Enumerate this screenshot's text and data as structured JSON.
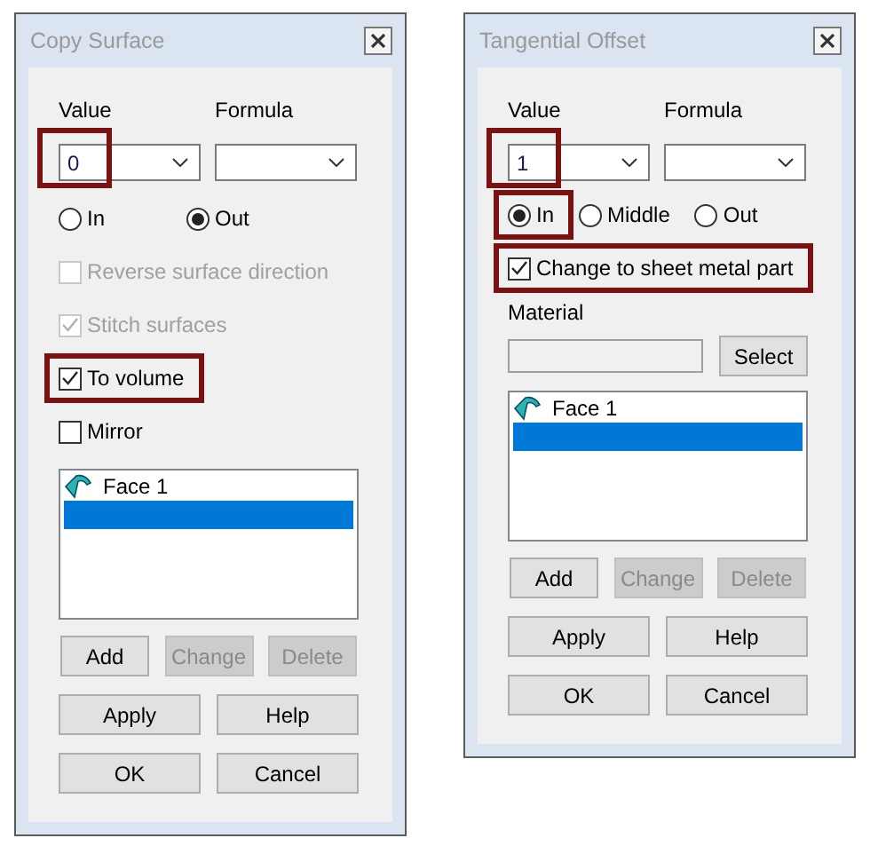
{
  "dialogs": [
    {
      "title": "Copy Surface",
      "value": {
        "label": "Value",
        "text": "0",
        "highlighted": true
      },
      "formula": {
        "label": "Formula"
      },
      "radios": [
        {
          "label": "In",
          "selected": false,
          "highlighted": false
        },
        {
          "label": "Out",
          "selected": true,
          "highlighted": false
        }
      ],
      "checkboxes": [
        {
          "label": "Reverse surface direction",
          "checked": false,
          "disabled": true,
          "highlighted": false
        },
        {
          "label": "Stitch surfaces",
          "checked": true,
          "disabled": true,
          "highlighted": false
        },
        {
          "label": "To volume",
          "checked": true,
          "disabled": false,
          "highlighted": true
        },
        {
          "label": "Mirror",
          "checked": false,
          "disabled": false,
          "highlighted": false
        }
      ],
      "list": [
        {
          "label": "Face 1",
          "selected": false
        },
        {
          "selected": true
        }
      ],
      "button_rows": [
        [
          {
            "label": "Add",
            "disabled": false
          },
          {
            "label": "Change",
            "disabled": true
          },
          {
            "label": "Delete",
            "disabled": true
          }
        ],
        [
          {
            "label": "Apply",
            "disabled": false
          },
          {
            "label": "Help",
            "disabled": false
          }
        ],
        [
          {
            "label": "OK",
            "disabled": false
          },
          {
            "label": "Cancel",
            "disabled": false
          }
        ]
      ]
    },
    {
      "title": "Tangential Offset",
      "value": {
        "label": "Value",
        "text": "1",
        "highlighted": true
      },
      "formula": {
        "label": "Formula"
      },
      "radios": [
        {
          "label": "In",
          "selected": true,
          "highlighted": true
        },
        {
          "label": "Middle",
          "selected": false,
          "highlighted": false
        },
        {
          "label": "Out",
          "selected": false,
          "highlighted": false
        }
      ],
      "checkboxes": [
        {
          "label": "Change to sheet metal part",
          "checked": true,
          "disabled": false,
          "highlighted": true
        }
      ],
      "material": {
        "label": "Material",
        "button": "Select"
      },
      "list": [
        {
          "label": "Face 1",
          "selected": false
        },
        {
          "selected": true
        }
      ],
      "button_rows": [
        [
          {
            "label": "Add",
            "disabled": false
          },
          {
            "label": "Change",
            "disabled": true
          },
          {
            "label": "Delete",
            "disabled": true
          }
        ],
        [
          {
            "label": "Apply",
            "disabled": false
          },
          {
            "label": "Help",
            "disabled": false
          }
        ],
        [
          {
            "label": "OK",
            "disabled": false
          },
          {
            "label": "Cancel",
            "disabled": false
          }
        ]
      ]
    }
  ]
}
